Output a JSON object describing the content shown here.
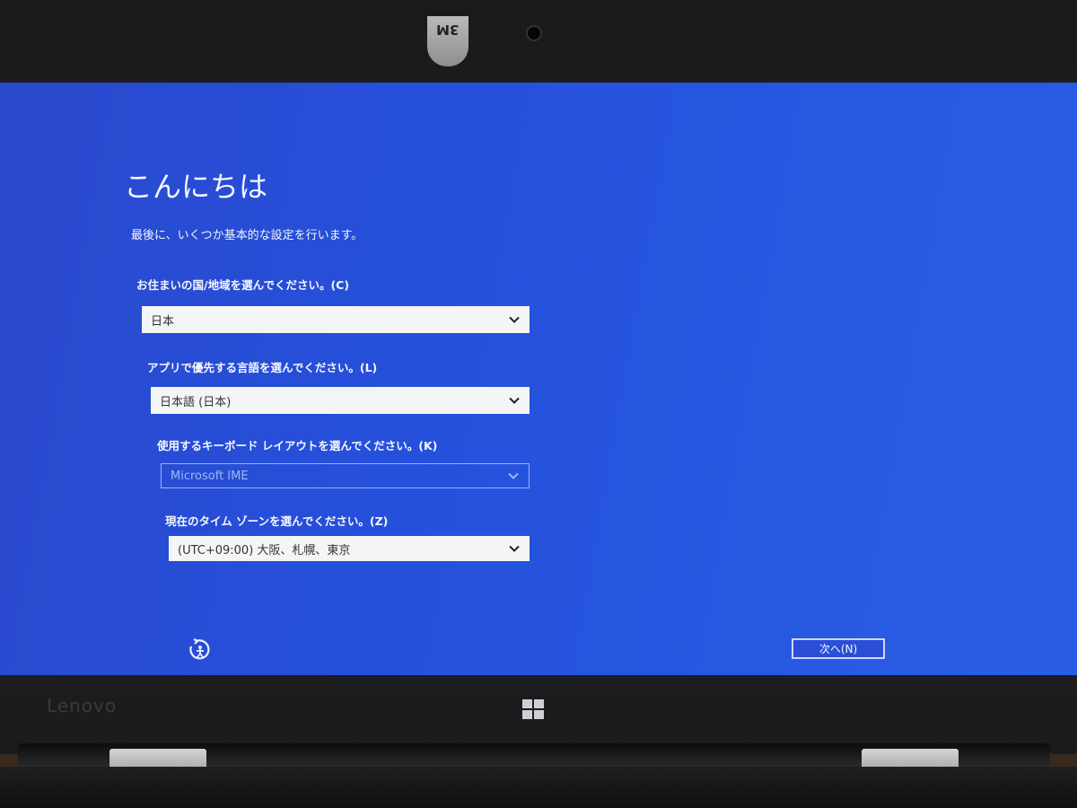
{
  "device": {
    "brand": "Lenovo",
    "webcam_cover_text": "3M"
  },
  "setup": {
    "title": "こんにちは",
    "subtitle": "最後に、いくつか基本的な設定を行います。",
    "fields": [
      {
        "label": "お住まいの国/地域を選んでください。(C)",
        "value": "日本",
        "enabled": true
      },
      {
        "label": "アプリで優先する言語を選んでください。(L)",
        "value": "日本語 (日本)",
        "enabled": true
      },
      {
        "label": "使用するキーボード レイアウトを選んでください。(K)",
        "value": "Microsoft IME",
        "enabled": false
      },
      {
        "label": "現在のタイム ゾーンを選んでください。(Z)",
        "value": "(UTC+09:00) 大阪、札幌、東京",
        "enabled": true
      }
    ],
    "next_button": "次へ(N)",
    "accessibility_icon": "ease-of-access-icon"
  },
  "colors": {
    "screen_blue": "#2550dc",
    "field_bg": "#f4f5f7",
    "text": "#f2f5ff"
  }
}
